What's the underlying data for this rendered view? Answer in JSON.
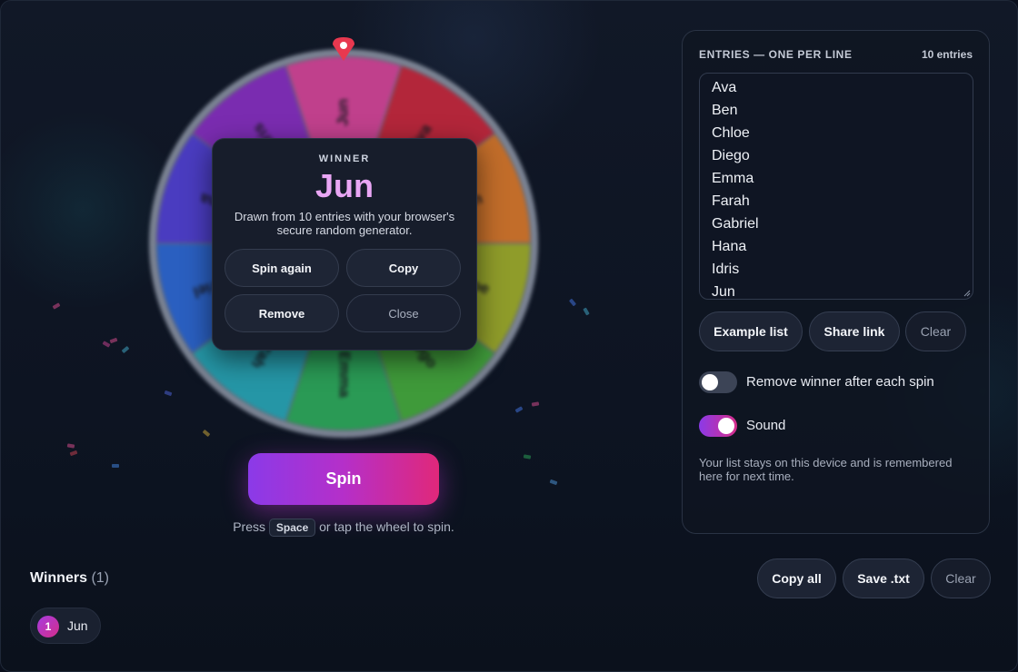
{
  "wheel": {
    "segments": [
      {
        "label": "Jun",
        "color": "#c0408c"
      },
      {
        "label": "Ava",
        "color": "#b3263a"
      },
      {
        "label": "Ben",
        "color": "#c26d2a"
      },
      {
        "label": "Chloe",
        "color": "#8f9c2a"
      },
      {
        "label": "Diego",
        "color": "#3f9a3a"
      },
      {
        "label": "Emma",
        "color": "#2a9a55"
      },
      {
        "label": "Farah",
        "color": "#2596a6"
      },
      {
        "label": "Gabriel",
        "color": "#2a5fc0"
      },
      {
        "label": "Hana",
        "color": "#4a3cc0"
      },
      {
        "label": "Idris",
        "color": "#7a2cb0"
      }
    ],
    "pointer_color": "#e8384f"
  },
  "winner_card": {
    "label": "WINNER",
    "name": "Jun",
    "description": "Drawn from 10 entries with your browser's secure random generator.",
    "spin_again": "Spin again",
    "copy": "Copy",
    "remove": "Remove",
    "close": "Close"
  },
  "spin": {
    "label": "Spin",
    "hint_before": "Press",
    "hint_key": "Space",
    "hint_after": "or tap the wheel to spin."
  },
  "entries_panel": {
    "title": "ENTRIES — ONE PER LINE",
    "count": "10 entries",
    "entries": [
      "Ava",
      "Ben",
      "Chloe",
      "Diego",
      "Emma",
      "Farah",
      "Gabriel",
      "Hana",
      "Idris",
      "Jun"
    ],
    "example_list": "Example list",
    "share_link": "Share link",
    "clear": "Clear",
    "toggles": [
      {
        "label": "Remove winner after each spin",
        "on": false
      },
      {
        "label": "Sound",
        "on": true
      }
    ],
    "note": "Your list stays on this device and is remembered here for next time."
  },
  "winners": {
    "title": "Winners",
    "count": "(1)",
    "copy_all": "Copy all",
    "save_txt": "Save .txt",
    "clear": "Clear",
    "list": [
      {
        "rank": "1",
        "name": "Jun"
      }
    ]
  },
  "colors": {
    "accent_start": "#8b3ae8",
    "accent_end": "#e0287a",
    "winner_name": "#e9a6f4"
  }
}
